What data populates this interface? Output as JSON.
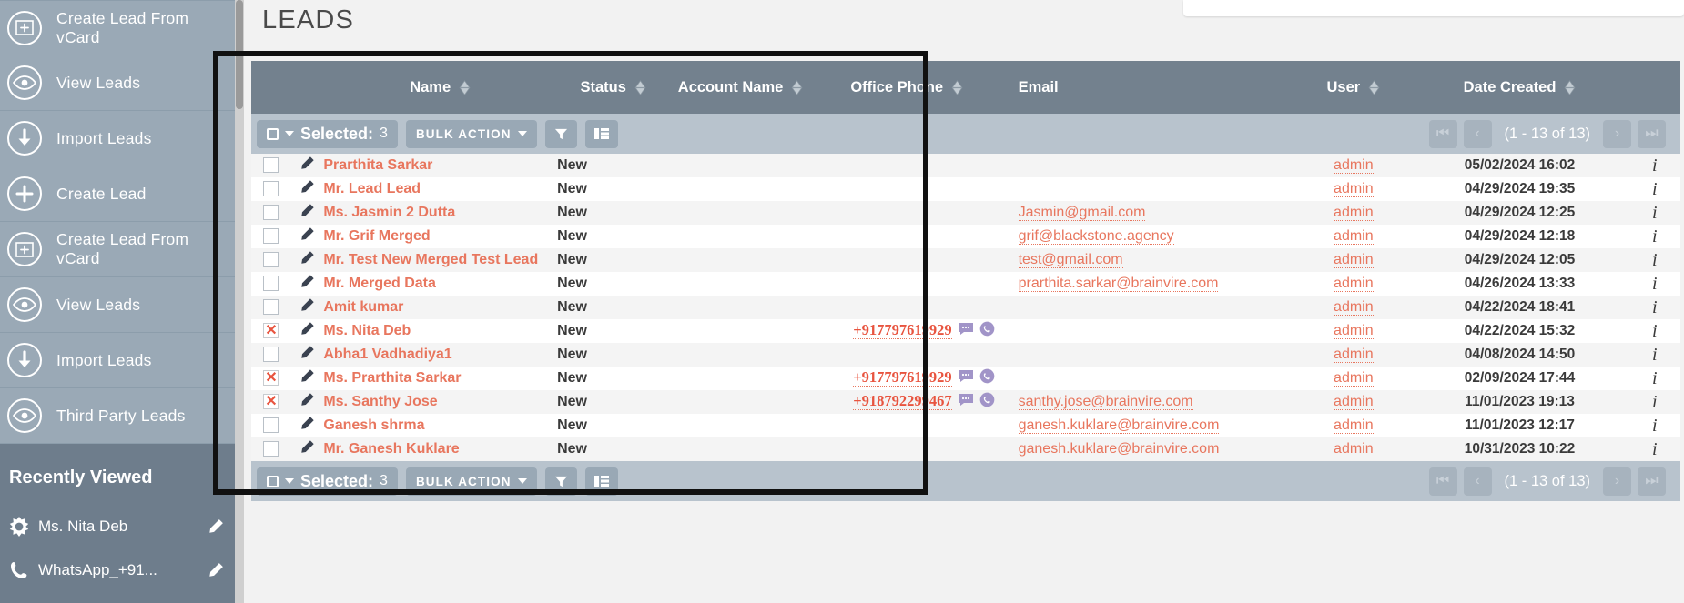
{
  "sidebar": {
    "nav_items": [
      {
        "label": "Create Lead From vCard",
        "icon": "square-plus-icon"
      },
      {
        "label": "View Leads",
        "icon": "eye-icon"
      },
      {
        "label": "Import Leads",
        "icon": "download-arrow-icon"
      },
      {
        "label": "Create Lead",
        "icon": "plus-icon"
      },
      {
        "label": "Create Lead From vCard",
        "icon": "square-plus-icon"
      },
      {
        "label": "View Leads",
        "icon": "eye-icon"
      },
      {
        "label": "Import Leads",
        "icon": "download-arrow-icon"
      },
      {
        "label": "Third Party Leads",
        "icon": "eye-icon"
      }
    ],
    "recently_viewed_title": "Recently Viewed",
    "recent_items": [
      {
        "label": "Ms. Nita Deb",
        "icon": "star-burst-icon",
        "action_icon": "pencil-icon"
      },
      {
        "label": "WhatsApp_+91...",
        "icon": "phone-icon",
        "action_icon": "pencil-icon"
      }
    ]
  },
  "page": {
    "title": "LEADS"
  },
  "table": {
    "columns": [
      {
        "label": "Name",
        "sortable": true
      },
      {
        "label": "Status",
        "sortable": true
      },
      {
        "label": "Account Name",
        "sortable": true
      },
      {
        "label": "Office Phone",
        "sortable": true
      },
      {
        "label": "Email",
        "sortable": false
      },
      {
        "label": "User",
        "sortable": true
      },
      {
        "label": "Date Created",
        "sortable": true
      }
    ],
    "toolbar": {
      "selected_label": "Selected:",
      "selected_count": "3",
      "bulk_action_label": "BULK ACTION",
      "filter_icon": "funnel-icon",
      "columns_icon": "column-chooser-icon",
      "pagination": {
        "first_icon": "page-first-icon",
        "prev_icon": "page-prev-icon",
        "range": "(1 - 13 of 13)",
        "next_icon": "page-next-icon",
        "last_icon": "page-last-icon"
      }
    },
    "rows": [
      {
        "checked": false,
        "name": "Prarthita Sarkar",
        "status": "New",
        "account": "",
        "phone": "",
        "email": "",
        "user": "admin",
        "date": "05/02/2024 16:02"
      },
      {
        "checked": false,
        "name": "Mr. Lead Lead",
        "status": "New",
        "account": "",
        "phone": "",
        "email": "",
        "user": "admin",
        "date": "04/29/2024 19:35"
      },
      {
        "checked": false,
        "name": "Ms. Jasmin 2 Dutta",
        "status": "New",
        "account": "",
        "phone": "",
        "email": "Jasmin@gmail.com",
        "user": "admin",
        "date": "04/29/2024 12:25"
      },
      {
        "checked": false,
        "name": "Mr. Grif Merged",
        "status": "New",
        "account": "",
        "phone": "",
        "email": "grif@blackstone.agency",
        "user": "admin",
        "date": "04/29/2024 12:18"
      },
      {
        "checked": false,
        "name": "Mr. Test New Merged Test Lead",
        "status": "New",
        "account": "",
        "phone": "",
        "email": "test@gmail.com",
        "user": "admin",
        "date": "04/29/2024 12:05"
      },
      {
        "checked": false,
        "name": "Mr. Merged Data",
        "status": "New",
        "account": "",
        "phone": "",
        "email": "prarthita.sarkar@brainvire.com",
        "user": "admin",
        "date": "04/26/2024 13:33"
      },
      {
        "checked": false,
        "name": "Amit kumar",
        "status": "New",
        "account": "",
        "phone": "",
        "email": "",
        "user": "admin",
        "date": "04/22/2024 18:41"
      },
      {
        "checked": true,
        "name": "Ms. Nita Deb",
        "status": "New",
        "account": "",
        "phone": "+917797619929",
        "email": "",
        "user": "admin",
        "date": "04/22/2024 15:32"
      },
      {
        "checked": false,
        "name": "Abha1 Vadhadiya1",
        "status": "New",
        "account": "",
        "phone": "",
        "email": "",
        "user": "admin",
        "date": "04/08/2024 14:50"
      },
      {
        "checked": true,
        "name": "Ms. Prarthita Sarkar",
        "status": "New",
        "account": "",
        "phone": "+917797619929",
        "email": "",
        "user": "admin",
        "date": "02/09/2024 17:44"
      },
      {
        "checked": true,
        "name": "Ms. Santhy Jose",
        "status": "New",
        "account": "",
        "phone": "+918792299467",
        "email": "santhy.jose@brainvire.com",
        "user": "admin",
        "date": "11/01/2023 19:13"
      },
      {
        "checked": false,
        "name": "Ganesh shrma",
        "status": "New",
        "account": "",
        "phone": "",
        "email": "ganesh.kuklare@brainvire.com",
        "user": "admin",
        "date": "11/01/2023 12:17"
      },
      {
        "checked": false,
        "name": "Mr. Ganesh Kuklare",
        "status": "New",
        "account": "",
        "phone": "",
        "email": "ganesh.kuklare@brainvire.com",
        "user": "admin",
        "date": "10/31/2023 10:22"
      }
    ]
  },
  "colors": {
    "accent_red": "#e8765e",
    "header_gray": "#73818e",
    "toolbar_gray": "#b8c3cd",
    "sidebar_gray": "#9aa9b6",
    "sidebar_dark": "#6e7d8c",
    "highlight_box": "#111111"
  }
}
